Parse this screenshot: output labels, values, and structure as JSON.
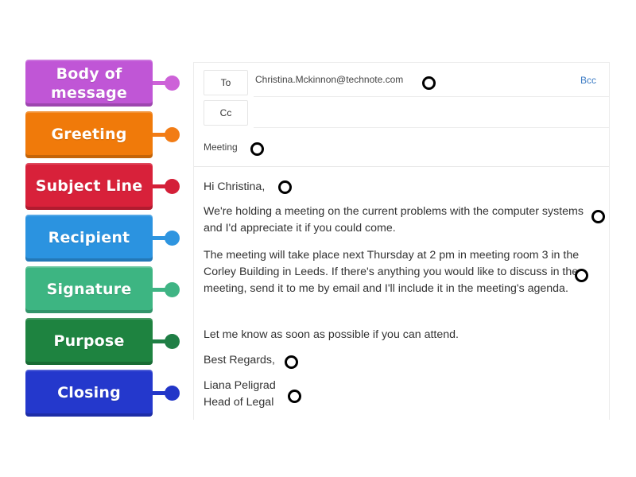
{
  "labels": [
    {
      "id": "body-of-message",
      "lines": [
        "Body of",
        "message"
      ],
      "color": "#c056d6",
      "conn": "#cd62d8"
    },
    {
      "id": "greeting",
      "lines": [
        "Greeting"
      ],
      "color": "#f07a0a",
      "conn": "#f27c15"
    },
    {
      "id": "subject-line",
      "lines": [
        "Subject Line"
      ],
      "color": "#d8213a",
      "conn": "#d41f38"
    },
    {
      "id": "recipient",
      "lines": [
        "Recipient"
      ],
      "color": "#2b93e0",
      "conn": "#2e95e0"
    },
    {
      "id": "signature",
      "lines": [
        "Signature"
      ],
      "color": "#3db582",
      "conn": "#3fb484"
    },
    {
      "id": "purpose",
      "lines": [
        "Purpose"
      ],
      "color": "#1e8340",
      "conn": "#1f7e45"
    },
    {
      "id": "closing",
      "lines": [
        "Closing"
      ],
      "color": "#2438cc",
      "conn": "#2236c8"
    }
  ],
  "email": {
    "to_label": "To",
    "to_value": "Christina.Mckinnon@technote.com",
    "cc_label": "Cc",
    "bcc_label": "Bcc",
    "subject": "Meeting",
    "greeting": "Hi Christina,",
    "paragraph1": "We're holding a meeting on the current problems with the computer systems and I'd appreciate it if you could come.",
    "paragraph2": "The meeting will take place next Thursday at 2 pm in meeting room 3 in the Corley Building in Leeds.  If there's anything you would like to discuss in the meeting, send it to me by email and I'll include it in the meeting's agenda.",
    "paragraph3": "Let me know as soon as possible if you can attend.",
    "closing": "Best Regards,",
    "signature_name": "Liana Peligrad",
    "signature_title": "Head of Legal"
  }
}
